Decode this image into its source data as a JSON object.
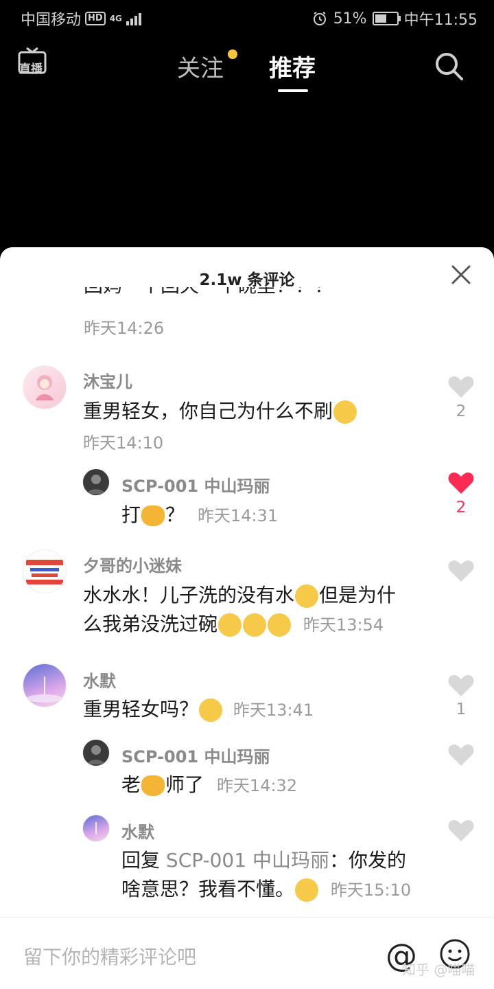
{
  "status_bar": {
    "carrier": "中国移动",
    "hd_badge": "HD",
    "network": "4G",
    "battery": "51%",
    "time": "中午11:55"
  },
  "top_nav": {
    "live_label": "直播",
    "tab_follow": "关注",
    "tab_recommend": "推荐"
  },
  "comments_sheet": {
    "title": "2.1w 条评论",
    "partial_top": {
      "text": "回妈一个回天一个碗里！！！",
      "time": "昨天14:26"
    },
    "comments": [
      {
        "user": "沐宝儿",
        "text": "重男轻女，你自己为什么不刷",
        "time": "昨天14:10",
        "likes": "2",
        "liked": false,
        "replies": [
          {
            "user": "SCP-001 中山玛丽",
            "text": "打",
            "text_after": "？",
            "time": "昨天14:31",
            "likes": "2",
            "liked": true
          }
        ]
      },
      {
        "user": "夕哥的小迷妹",
        "text_line1": "水水水！儿子洗的没有水",
        "text_line1b": "但是为什",
        "text_line2": "么我弟没洗过碗",
        "time": "昨天13:54",
        "likes": "",
        "liked": false
      },
      {
        "user": "水默",
        "text": "重男轻女吗？",
        "time": "昨天13:41",
        "likes": "1",
        "liked": false,
        "replies": [
          {
            "user": "SCP-001 中山玛丽",
            "text_a": "老",
            "text_b": "师了",
            "time": "昨天14:32",
            "likes": "",
            "liked": false
          },
          {
            "user": "水默",
            "reply_prefix": "回复",
            "reply_to": "SCP-001 中山玛丽",
            "text_line1": "：你发的",
            "text_line2": "啥意思？我看不懂。",
            "time": "昨天15:10",
            "likes": "",
            "liked": false
          }
        ]
      }
    ]
  },
  "input_bar": {
    "placeholder": "留下你的精彩评论吧",
    "at_symbol": "@",
    "watermark": "知乎 @喵喵"
  },
  "colors": {
    "like_active": "#fe2c55",
    "accent_dot": "#f9c63b"
  }
}
